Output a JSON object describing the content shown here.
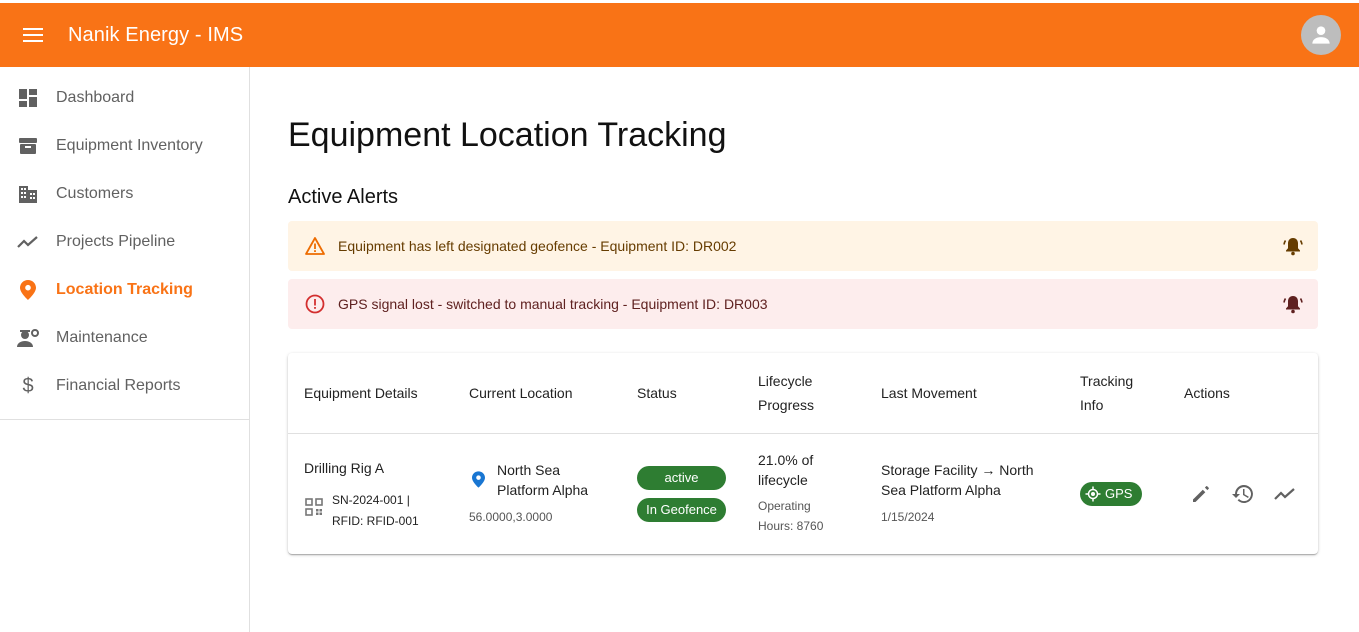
{
  "app": {
    "title": "Nanik Energy - IMS"
  },
  "sidebar": {
    "items": [
      {
        "label": "Dashboard",
        "icon": "dashboard-icon"
      },
      {
        "label": "Equipment Inventory",
        "icon": "inventory-icon"
      },
      {
        "label": "Customers",
        "icon": "building-icon"
      },
      {
        "label": "Projects Pipeline",
        "icon": "trending-icon"
      },
      {
        "label": "Location Tracking",
        "icon": "location-pin-icon",
        "active": true
      },
      {
        "label": "Maintenance",
        "icon": "engineering-icon"
      },
      {
        "label": "Financial Reports",
        "icon": "dollar-icon"
      }
    ]
  },
  "main": {
    "title": "Equipment Location Tracking",
    "alerts_title": "Active Alerts",
    "alerts": [
      {
        "severity": "warning",
        "text": "Equipment has left designated geofence - Equipment ID: DR002"
      },
      {
        "severity": "error",
        "text": "GPS signal lost - switched to manual tracking - Equipment ID: DR003"
      }
    ],
    "table": {
      "headers": {
        "equipment": "Equipment Details",
        "location": "Current Location",
        "status": "Status",
        "lifecycle_1": "Lifecycle",
        "lifecycle_2": "Progress",
        "movement": "Last Movement",
        "tracking_1": "Tracking",
        "tracking_2": "Info",
        "actions": "Actions"
      },
      "rows": [
        {
          "name": "Drilling Rig A",
          "ids_1": "SN-2024-001 |",
          "ids_2": "RFID: RFID-001",
          "location_1": "North Sea",
          "location_2": "Platform Alpha",
          "coords": "56.0000,3.0000",
          "status": "active",
          "geofence": "In Geofence",
          "lifecycle_1": "21.0% of",
          "lifecycle_2": "lifecycle",
          "hours_1": "Operating",
          "hours_2": "Hours: 8760",
          "movement_1": "Storage Facility → North",
          "movement_2": "Sea Platform Alpha",
          "movement_date": "1/15/2024",
          "tracking": "GPS"
        }
      ]
    }
  },
  "colors": {
    "brand": "#f97316",
    "success": "#2e7d32",
    "warning_bg": "#fff4e5",
    "error_bg": "#fdeded"
  }
}
